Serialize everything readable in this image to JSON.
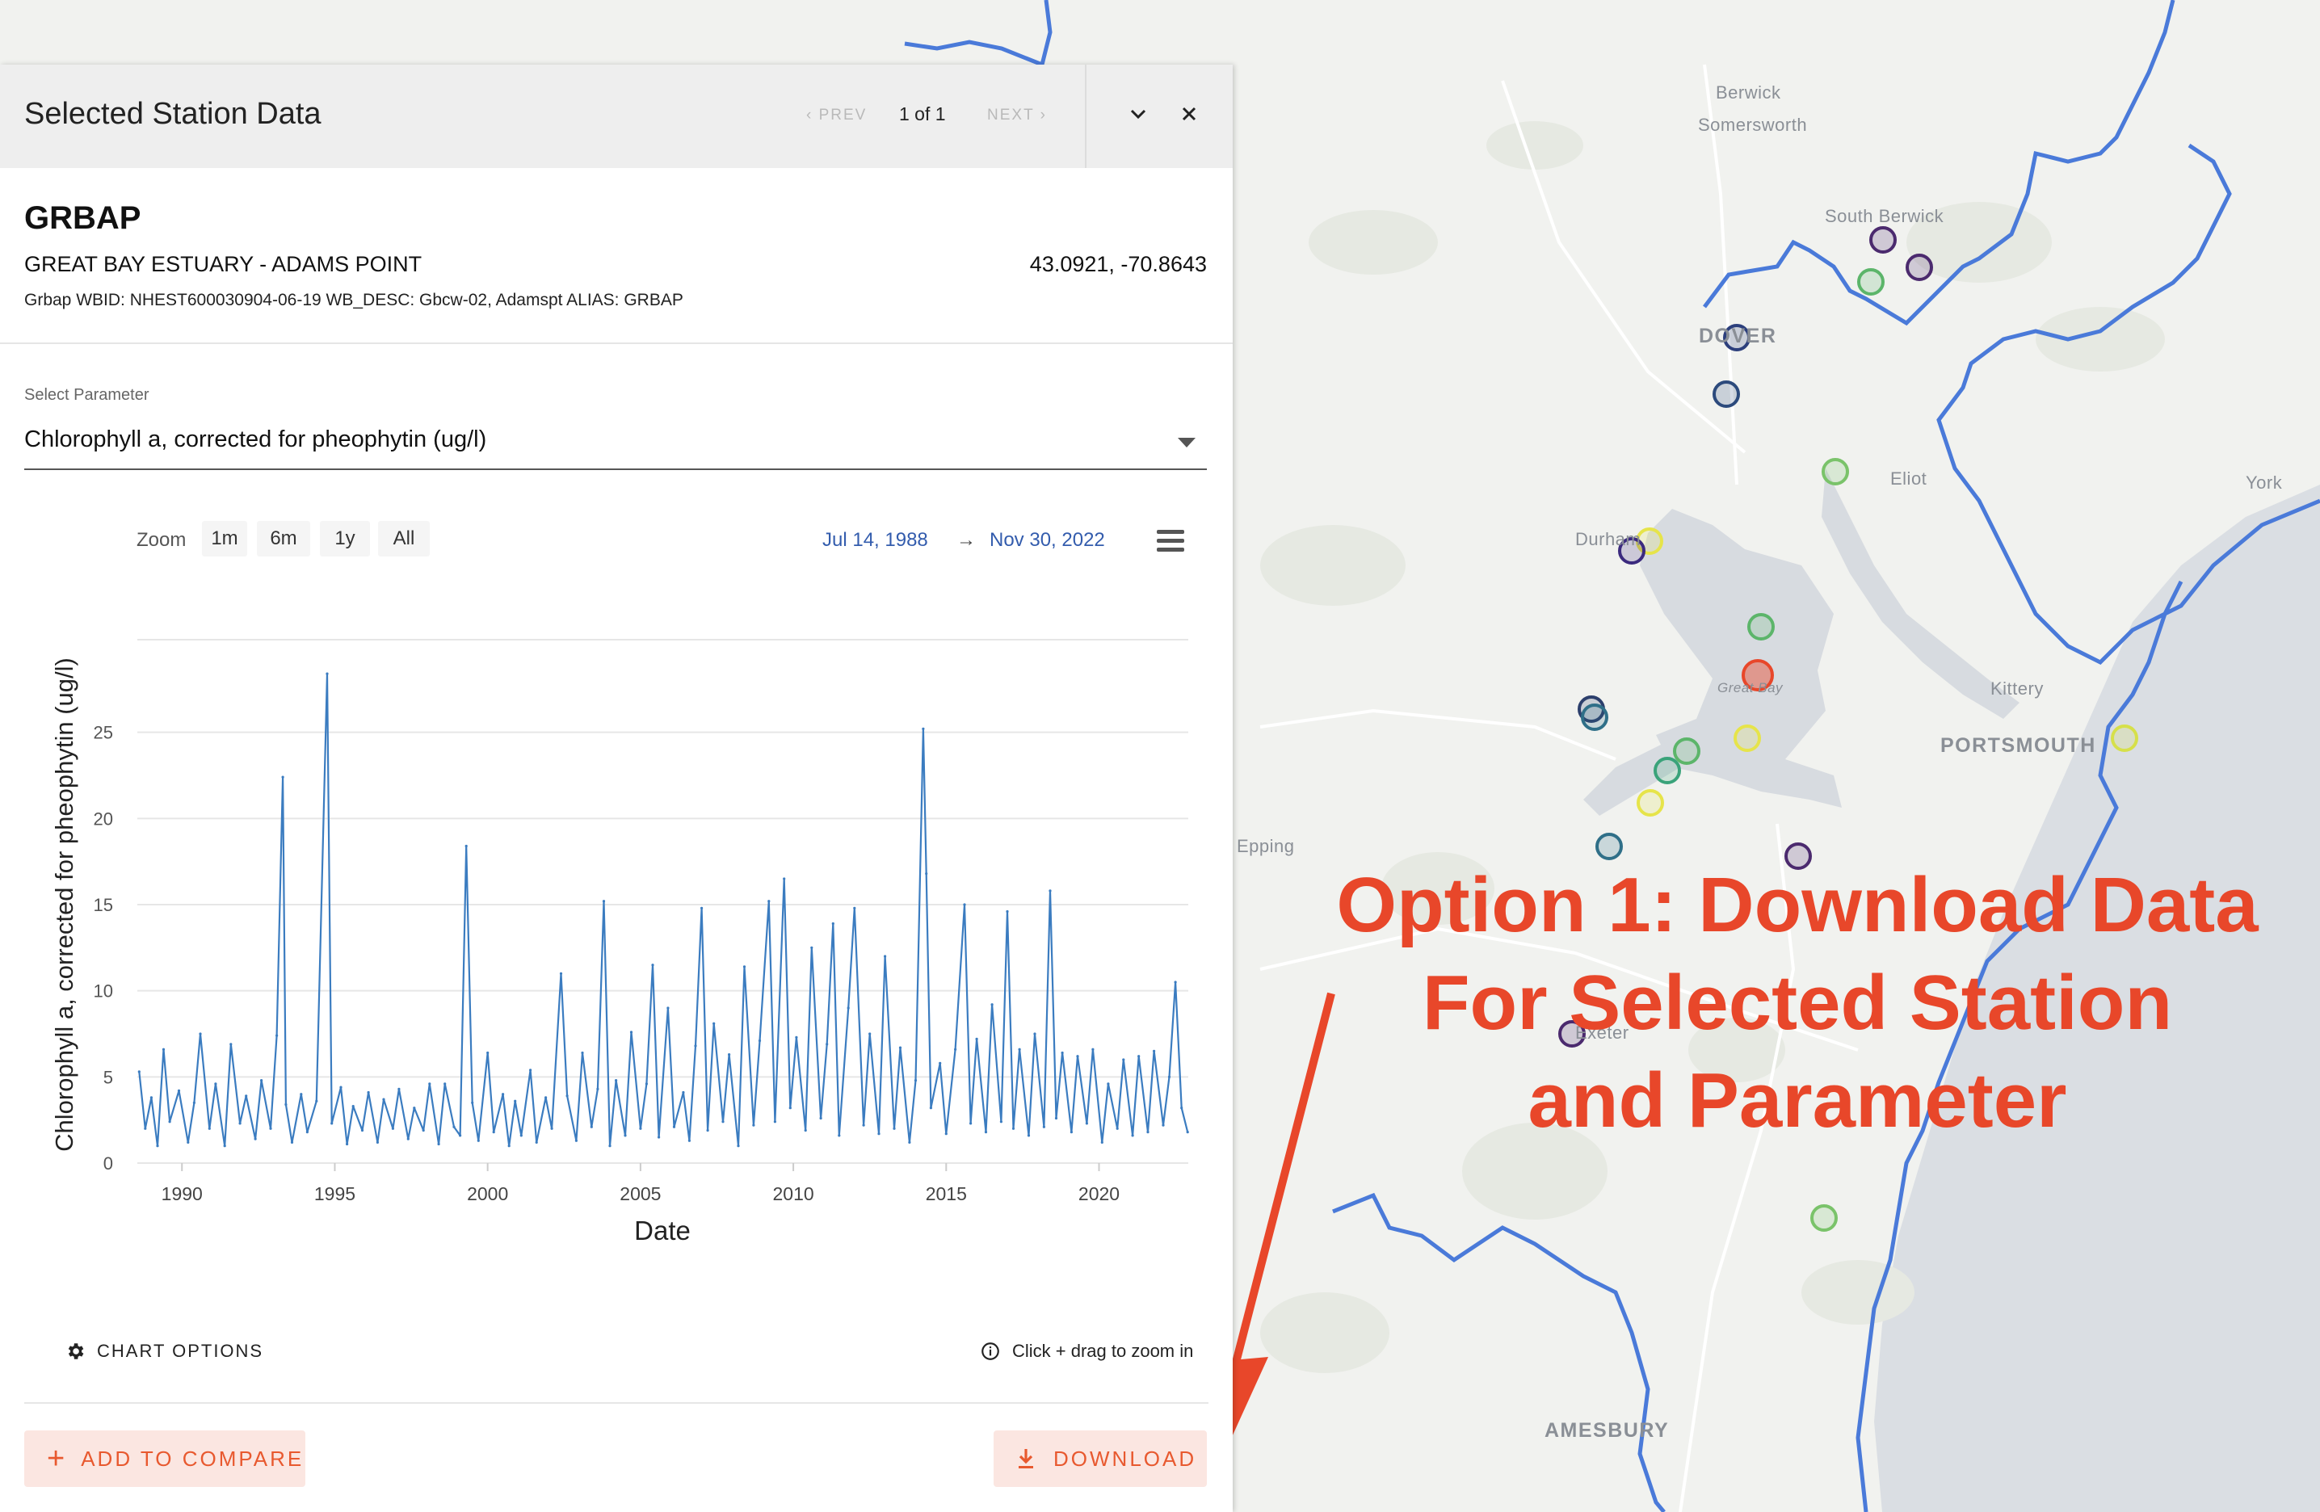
{
  "panel": {
    "title": "Selected Station Data",
    "prev_label": "‹ PREV",
    "next_label": "NEXT ›",
    "page_count": "1 of 1"
  },
  "station": {
    "id": "GRBAP",
    "name": "GREAT BAY ESTUARY - ADAMS POINT",
    "coords": "43.0921, -70.8643",
    "meta": "Grbap WBID: NHEST600030904-06-19 WB_DESC: Gbcw-02, Adamspt ALIAS: GRBAP"
  },
  "parameter": {
    "label": "Select Parameter",
    "value": "Chlorophyll a, corrected for pheophytin (ug/l)"
  },
  "zoom": {
    "label": "Zoom",
    "buttons": [
      "1m",
      "6m",
      "1y",
      "All"
    ],
    "range_from": "Jul 14, 1988",
    "arrow": "→",
    "range_to": "Nov 30, 2022"
  },
  "chart_data": {
    "type": "line",
    "xlabel": "Date",
    "ylabel": "Chlorophyll a, corrected for pheophytin (ug/l)",
    "xlim": [
      1988.54,
      2022.92
    ],
    "ylim": [
      0,
      30
    ],
    "x_ticks": [
      "1990",
      "1995",
      "2000",
      "2005",
      "2010",
      "2015",
      "2020"
    ],
    "y_ticks": [
      "0",
      "5",
      "10",
      "15",
      "20",
      "25"
    ],
    "grid": true,
    "legend": "none",
    "line_color": "#3b7cc0",
    "navigator_ticks": [
      "1990",
      "2000",
      "2010",
      "2020"
    ],
    "peaks": [
      {
        "x": 1993.3,
        "y": 22.4
      },
      {
        "x": 1994.75,
        "y": 28.4
      },
      {
        "x": 1999.3,
        "y": 18.4
      },
      {
        "x": 2002.4,
        "y": 11.0
      },
      {
        "x": 2003.8,
        "y": 15.2
      },
      {
        "x": 2005.4,
        "y": 11.5
      },
      {
        "x": 2007.0,
        "y": 14.8
      },
      {
        "x": 2009.2,
        "y": 15.2
      },
      {
        "x": 2009.7,
        "y": 16.5
      },
      {
        "x": 2011.3,
        "y": 13.9
      },
      {
        "x": 2012.0,
        "y": 14.8
      },
      {
        "x": 2014.25,
        "y": 25.2
      },
      {
        "x": 2015.6,
        "y": 15.0
      },
      {
        "x": 2017.0,
        "y": 14.6
      },
      {
        "x": 2018.4,
        "y": 15.8
      },
      {
        "x": 2022.5,
        "y": 10.5
      }
    ],
    "series": [
      {
        "x": 1988.6,
        "y": 5.3
      },
      {
        "x": 1988.8,
        "y": 2.0
      },
      {
        "x": 1989.0,
        "y": 3.8
      },
      {
        "x": 1989.2,
        "y": 1.0
      },
      {
        "x": 1989.4,
        "y": 6.6
      },
      {
        "x": 1989.6,
        "y": 2.4
      },
      {
        "x": 1989.9,
        "y": 4.2
      },
      {
        "x": 1990.2,
        "y": 1.2
      },
      {
        "x": 1990.4,
        "y": 3.5
      },
      {
        "x": 1990.6,
        "y": 7.5
      },
      {
        "x": 1990.9,
        "y": 2.0
      },
      {
        "x": 1991.1,
        "y": 4.6
      },
      {
        "x": 1991.4,
        "y": 1.0
      },
      {
        "x": 1991.6,
        "y": 6.9
      },
      {
        "x": 1991.9,
        "y": 2.3
      },
      {
        "x": 1992.1,
        "y": 3.9
      },
      {
        "x": 1992.4,
        "y": 1.4
      },
      {
        "x": 1992.6,
        "y": 4.8
      },
      {
        "x": 1992.9,
        "y": 2.0
      },
      {
        "x": 1993.1,
        "y": 7.4
      },
      {
        "x": 1993.4,
        "y": 3.4
      },
      {
        "x": 1993.6,
        "y": 1.2
      },
      {
        "x": 1993.9,
        "y": 4.0
      },
      {
        "x": 1994.1,
        "y": 1.8
      },
      {
        "x": 1994.4,
        "y": 3.6
      },
      {
        "x": 1994.9,
        "y": 2.3
      },
      {
        "x": 1995.2,
        "y": 4.4
      },
      {
        "x": 1995.4,
        "y": 1.1
      },
      {
        "x": 1995.6,
        "y": 3.3
      },
      {
        "x": 1995.9,
        "y": 1.9
      },
      {
        "x": 1996.1,
        "y": 4.1
      },
      {
        "x": 1996.4,
        "y": 1.2
      },
      {
        "x": 1996.6,
        "y": 3.7
      },
      {
        "x": 1996.9,
        "y": 2.0
      },
      {
        "x": 1997.1,
        "y": 4.3
      },
      {
        "x": 1997.4,
        "y": 1.4
      },
      {
        "x": 1997.6,
        "y": 3.2
      },
      {
        "x": 1997.9,
        "y": 1.9
      },
      {
        "x": 1998.1,
        "y": 4.6
      },
      {
        "x": 1998.4,
        "y": 1.1
      },
      {
        "x": 1998.6,
        "y": 4.6
      },
      {
        "x": 1998.9,
        "y": 2.1
      },
      {
        "x": 1999.1,
        "y": 1.6
      },
      {
        "x": 1999.5,
        "y": 3.5
      },
      {
        "x": 1999.7,
        "y": 1.3
      },
      {
        "x": 2000.0,
        "y": 6.4
      },
      {
        "x": 2000.2,
        "y": 1.8
      },
      {
        "x": 2000.5,
        "y": 4.0
      },
      {
        "x": 2000.7,
        "y": 1.0
      },
      {
        "x": 2000.9,
        "y": 3.6
      },
      {
        "x": 2001.1,
        "y": 1.6
      },
      {
        "x": 2001.4,
        "y": 5.4
      },
      {
        "x": 2001.6,
        "y": 1.2
      },
      {
        "x": 2001.9,
        "y": 3.8
      },
      {
        "x": 2002.1,
        "y": 2.0
      },
      {
        "x": 2002.6,
        "y": 3.9
      },
      {
        "x": 2002.9,
        "y": 1.3
      },
      {
        "x": 2003.1,
        "y": 6.4
      },
      {
        "x": 2003.4,
        "y": 2.1
      },
      {
        "x": 2003.6,
        "y": 4.3
      },
      {
        "x": 2004.0,
        "y": 1.0
      },
      {
        "x": 2004.2,
        "y": 4.8
      },
      {
        "x": 2004.5,
        "y": 1.6
      },
      {
        "x": 2004.7,
        "y": 7.6
      },
      {
        "x": 2005.0,
        "y": 2.0
      },
      {
        "x": 2005.2,
        "y": 4.6
      },
      {
        "x": 2005.6,
        "y": 1.5
      },
      {
        "x": 2005.9,
        "y": 9.0
      },
      {
        "x": 2006.1,
        "y": 2.1
      },
      {
        "x": 2006.4,
        "y": 4.1
      },
      {
        "x": 2006.6,
        "y": 1.3
      },
      {
        "x": 2006.8,
        "y": 6.8
      },
      {
        "x": 2007.2,
        "y": 1.9
      },
      {
        "x": 2007.4,
        "y": 8.1
      },
      {
        "x": 2007.7,
        "y": 2.4
      },
      {
        "x": 2007.9,
        "y": 6.3
      },
      {
        "x": 2008.2,
        "y": 1.0
      },
      {
        "x": 2008.4,
        "y": 11.4
      },
      {
        "x": 2008.7,
        "y": 2.2
      },
      {
        "x": 2008.9,
        "y": 7.1
      },
      {
        "x": 2009.4,
        "y": 2.4
      },
      {
        "x": 2009.9,
        "y": 3.2
      },
      {
        "x": 2010.1,
        "y": 7.3
      },
      {
        "x": 2010.4,
        "y": 1.9
      },
      {
        "x": 2010.6,
        "y": 12.5
      },
      {
        "x": 2010.9,
        "y": 2.6
      },
      {
        "x": 2011.1,
        "y": 6.9
      },
      {
        "x": 2011.5,
        "y": 1.6
      },
      {
        "x": 2011.8,
        "y": 9.0
      },
      {
        "x": 2012.3,
        "y": 2.2
      },
      {
        "x": 2012.5,
        "y": 7.5
      },
      {
        "x": 2012.8,
        "y": 1.7
      },
      {
        "x": 2013.0,
        "y": 12.0
      },
      {
        "x": 2013.3,
        "y": 2.0
      },
      {
        "x": 2013.5,
        "y": 6.7
      },
      {
        "x": 2013.8,
        "y": 1.2
      },
      {
        "x": 2014.0,
        "y": 4.8
      },
      {
        "x": 2014.35,
        "y": 16.8
      },
      {
        "x": 2014.5,
        "y": 3.2
      },
      {
        "x": 2014.8,
        "y": 5.8
      },
      {
        "x": 2015.0,
        "y": 1.7
      },
      {
        "x": 2015.3,
        "y": 6.6
      },
      {
        "x": 2015.8,
        "y": 2.3
      },
      {
        "x": 2016.0,
        "y": 7.2
      },
      {
        "x": 2016.3,
        "y": 1.8
      },
      {
        "x": 2016.5,
        "y": 9.2
      },
      {
        "x": 2016.8,
        "y": 2.4
      },
      {
        "x": 2017.2,
        "y": 2.0
      },
      {
        "x": 2017.4,
        "y": 6.6
      },
      {
        "x": 2017.7,
        "y": 1.6
      },
      {
        "x": 2017.9,
        "y": 7.5
      },
      {
        "x": 2018.2,
        "y": 2.1
      },
      {
        "x": 2018.6,
        "y": 2.6
      },
      {
        "x": 2018.8,
        "y": 6.4
      },
      {
        "x": 2019.1,
        "y": 1.8
      },
      {
        "x": 2019.3,
        "y": 6.2
      },
      {
        "x": 2019.6,
        "y": 2.3
      },
      {
        "x": 2019.8,
        "y": 6.6
      },
      {
        "x": 2020.1,
        "y": 1.2
      },
      {
        "x": 2020.3,
        "y": 4.6
      },
      {
        "x": 2020.6,
        "y": 2.0
      },
      {
        "x": 2020.8,
        "y": 6.0
      },
      {
        "x": 2021.1,
        "y": 1.6
      },
      {
        "x": 2021.3,
        "y": 6.2
      },
      {
        "x": 2021.6,
        "y": 1.8
      },
      {
        "x": 2021.8,
        "y": 6.5
      },
      {
        "x": 2022.1,
        "y": 2.2
      },
      {
        "x": 2022.3,
        "y": 5.0
      },
      {
        "x": 2022.7,
        "y": 3.2
      },
      {
        "x": 2022.9,
        "y": 1.8
      }
    ]
  },
  "footer": {
    "chart_options_label": "CHART OPTIONS",
    "hint": "Click + drag to zoom in",
    "add_compare_label": "ADD TO COMPARE",
    "download_label": "DOWNLOAD"
  },
  "map": {
    "places": [
      {
        "id": "berwick",
        "label": "Berwick"
      },
      {
        "id": "somersworth",
        "label": "Somersworth"
      },
      {
        "id": "south-berwick",
        "label": "South Berwick"
      },
      {
        "id": "dover",
        "label": "DOVER"
      },
      {
        "id": "eliot",
        "label": "Eliot"
      },
      {
        "id": "york",
        "label": "York"
      },
      {
        "id": "durham",
        "label": "Durham"
      },
      {
        "id": "great-bay",
        "label": "Great Bay"
      },
      {
        "id": "kittery",
        "label": "Kittery"
      },
      {
        "id": "portsmouth",
        "label": "PORTSMOUTH"
      },
      {
        "id": "epping",
        "label": "Epping"
      },
      {
        "id": "exeter",
        "label": "Exeter"
      },
      {
        "id": "amesbury",
        "label": "AMESBURY"
      }
    ],
    "station_colors": {
      "purple": "#4b2a6e",
      "navy": "#2c4a7c",
      "teal": "#2f6f88",
      "green": "#5cb56a",
      "yellow": "#e6e44a",
      "selected": "#e8472a"
    }
  },
  "annotation": {
    "line1": "Option 1: Download Data",
    "line2": "For Selected Station",
    "line3": "and Parameter",
    "color": "#e8472a"
  }
}
